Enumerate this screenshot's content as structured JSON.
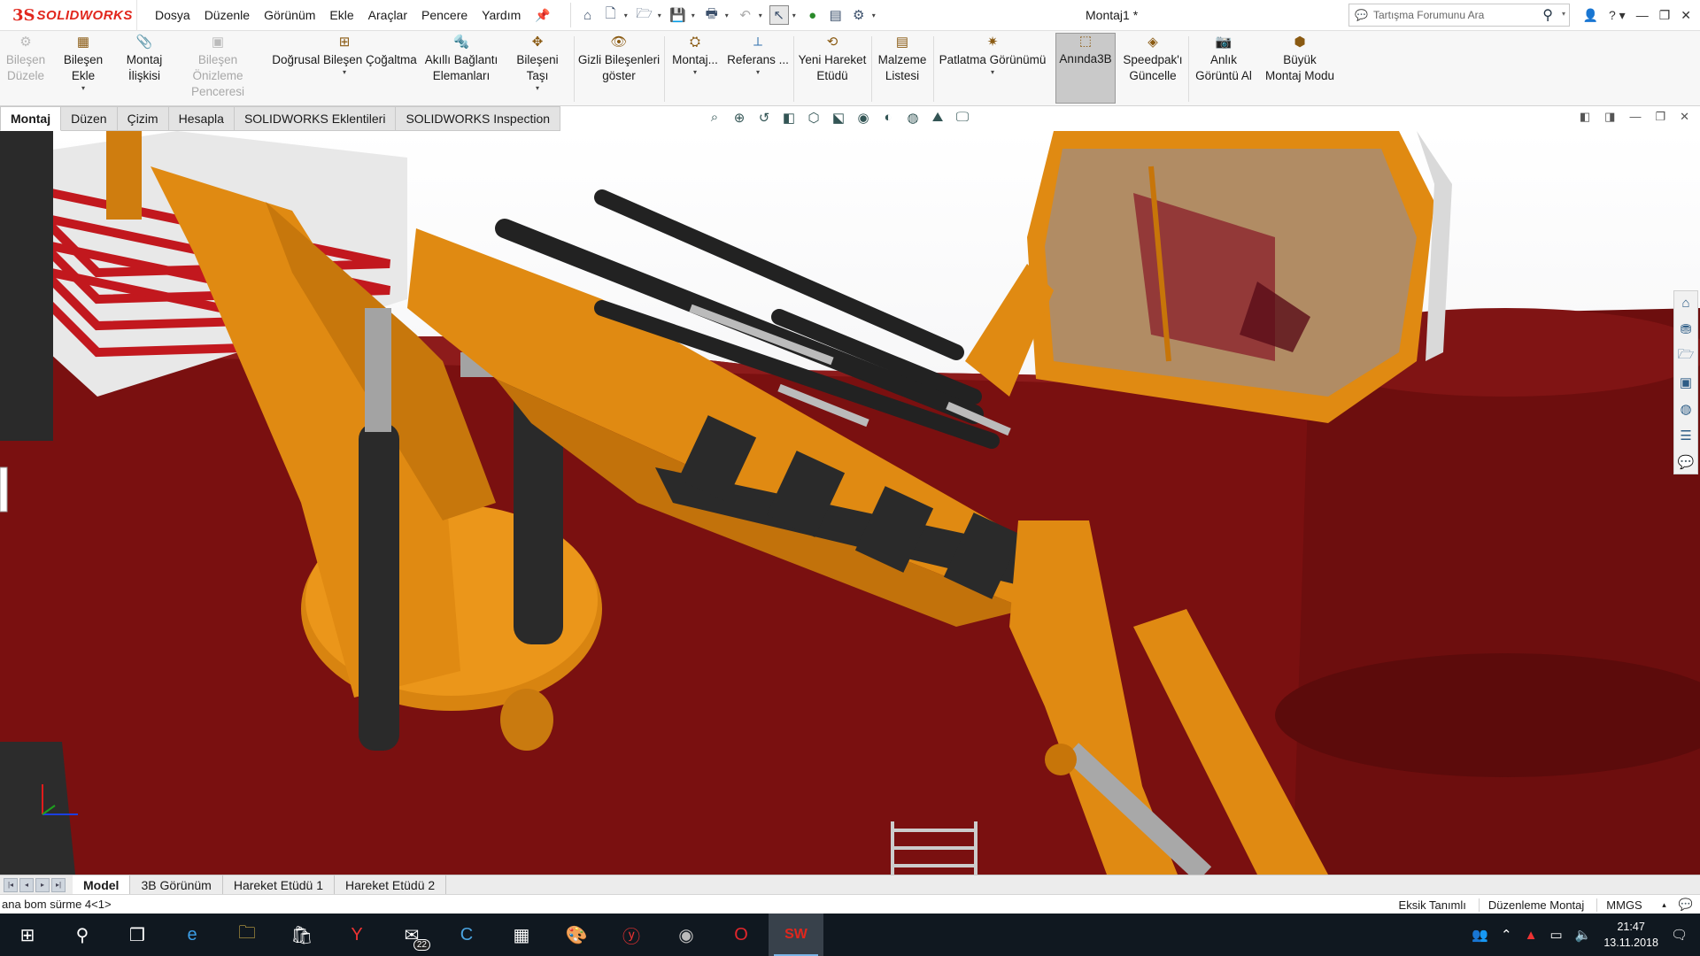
{
  "app": {
    "logo_ds": "3S",
    "logo_text": "SOLIDWORKS",
    "menus": [
      "Dosya",
      "Düzenle",
      "Görünüm",
      "Ekle",
      "Araçlar",
      "Pencere",
      "Yardım"
    ],
    "document_title": "Montaj1 *",
    "search_placeholder": "Tartışma Forumunu Ara"
  },
  "ribbon": {
    "edit_component": [
      "Bileşen",
      "Düzele"
    ],
    "insert_component": "Bileşen Ekle",
    "mate": [
      "Montaj",
      "İlişkisi"
    ],
    "preview_window": [
      "Bileşen Önizleme",
      "Penceresi"
    ],
    "linear_pattern": "Doğrusal Bileşen Çoğaltma",
    "smart_fasteners": [
      "Akıllı Bağlantı",
      "Elemanları"
    ],
    "move_component": "Bileşeni Taşı",
    "show_hidden": [
      "Gizli Bileşenleri",
      "göster"
    ],
    "assembly_features": "Montaj...",
    "reference": "Referans ...",
    "new_motion": [
      "Yeni Hareket",
      "Etüdü"
    ],
    "bom": [
      "Malzeme",
      "Listesi"
    ],
    "exploded_view": "Patlatma Görünümü",
    "instant3d": "Anında3B",
    "speedpak": [
      "Speedpak'ı",
      "Güncelle"
    ],
    "snapshot": [
      "Anlık",
      "Görüntü Al"
    ],
    "large_assembly": [
      "Büyük",
      "Montaj Modu"
    ]
  },
  "command_tabs": [
    "Montaj",
    "Düzen",
    "Çizim",
    "Hesapla",
    "SOLIDWORKS Eklentileri",
    "SOLIDWORKS Inspection"
  ],
  "model_tabs": [
    "Model",
    "3B Görünüm",
    "Hareket Etüdü 1",
    "Hareket Etüdü 2"
  ],
  "status": {
    "left": "ana bom sürme 4<1>",
    "under_defined": "Eksik Tanımlı",
    "editing": "Düzenleme Montaj",
    "units": "MMGS"
  },
  "taskbar": {
    "mail_badge": "22",
    "time": "21:47",
    "date": "13.11.2018"
  },
  "colors": {
    "crane_orange": "#E08A12",
    "deck_maroon": "#7A1010",
    "solidworks_red": "#E1261C"
  }
}
